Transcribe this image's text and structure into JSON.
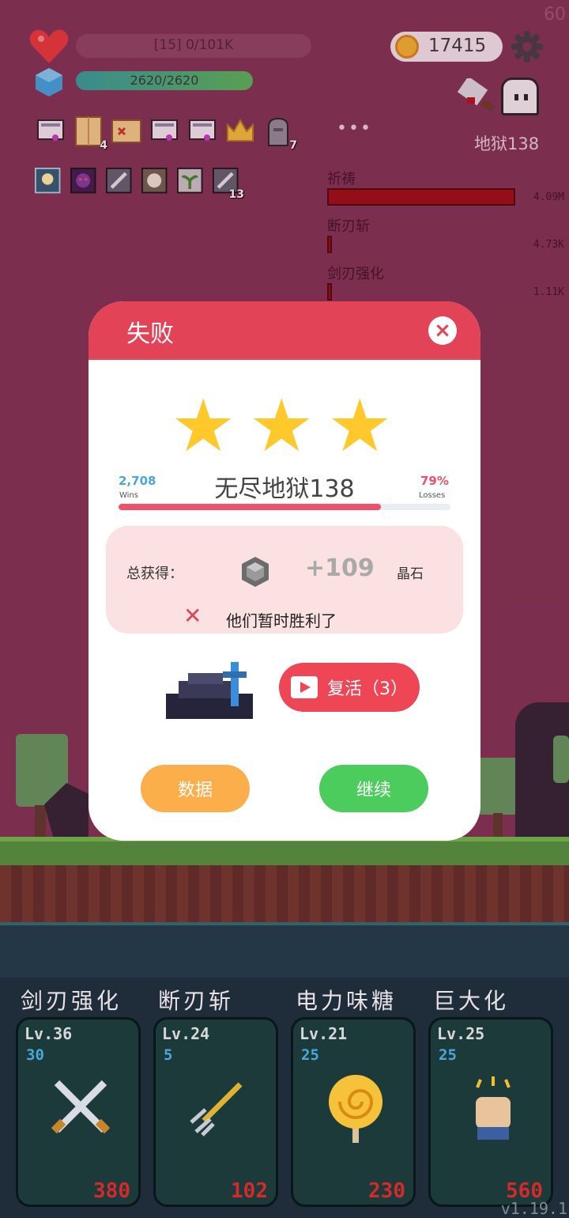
{
  "hud": {
    "fps": "60",
    "hp_text": "[15] 0/101K",
    "hp_fraction": 0.0,
    "mana_text": "2620/2620",
    "mana_fraction": 1.0,
    "coins": "17415",
    "stage": "地狱138",
    "more": "•••",
    "inventory_items": [
      {
        "icon": "scroll-cart-icon",
        "count": ""
      },
      {
        "icon": "map-icon",
        "count": "4"
      },
      {
        "icon": "treasure-map-icon",
        "count": ""
      },
      {
        "icon": "scroll-cart-icon",
        "count": ""
      },
      {
        "icon": "scroll-cart-icon",
        "count": ""
      },
      {
        "icon": "crown-icon",
        "count": ""
      },
      {
        "icon": "tombstone-icon",
        "count": "7"
      }
    ],
    "buffs": [
      {
        "icon": "lightbulb-buff-icon",
        "count": ""
      },
      {
        "icon": "demon-buff-icon",
        "count": ""
      },
      {
        "icon": "sword-buff-icon",
        "count": ""
      },
      {
        "icon": "burst-buff-icon",
        "count": ""
      },
      {
        "icon": "sprout-buff-icon",
        "count": ""
      },
      {
        "icon": "sword-buff-icon",
        "count": "13"
      }
    ]
  },
  "damage_stats": [
    {
      "label": "祈祷",
      "value": "4.09M",
      "fraction": 1.0
    },
    {
      "label": "断刃斩",
      "value": "4.73K",
      "fraction": 0.0012
    },
    {
      "label": "剑刃强化",
      "value": "1.11K",
      "fraction": 0.0003
    }
  ],
  "modal": {
    "title": "失败",
    "close": "×",
    "stars": 3,
    "wins_value": "2,708",
    "wins_label": "Wins",
    "losses_value": "79%",
    "losses_label": "Losses",
    "stage_name": "无尽地狱138",
    "progress_fraction": 0.79,
    "reward_label": "总获得：",
    "reward_amount": "+109",
    "reward_unit": "晶石",
    "reward_icon": "crystal-icon",
    "result_text": "他们暂时胜利了",
    "revive_label": "复活（3）",
    "stats_button": "数据",
    "continue_button": "继续",
    "colors": {
      "header": "#e24356",
      "stats_button": "#fcae4a",
      "continue_button": "#4ccc5c",
      "wins": "#4aa8d8",
      "losses": "#f05068"
    }
  },
  "skills": [
    {
      "name": "剑刃强化",
      "level": "Lv.36",
      "cost": "30",
      "price": "380",
      "icon": "crossed-swords-icon"
    },
    {
      "name": "断刃斩",
      "level": "Lv.24",
      "cost": "5",
      "price": "102",
      "icon": "trident-icon"
    },
    {
      "name": "电力味糖",
      "level": "Lv.21",
      "cost": "25",
      "price": "230",
      "icon": "lollipop-icon"
    },
    {
      "name": "巨大化",
      "level": "Lv.25",
      "cost": "25",
      "price": "560",
      "icon": "fist-icon"
    }
  ],
  "version": "v1.19.1"
}
